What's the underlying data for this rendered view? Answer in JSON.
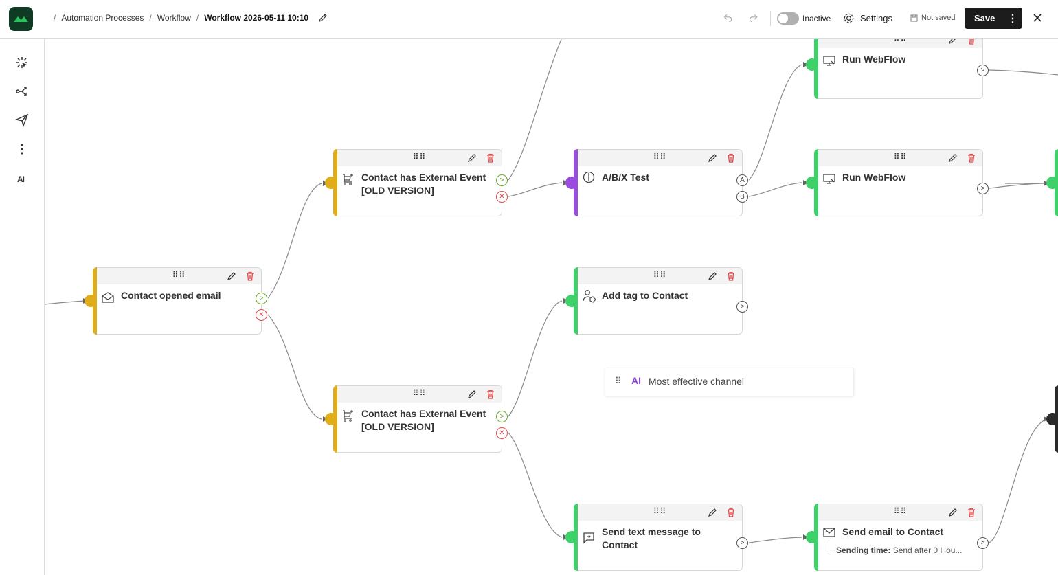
{
  "breadcrumb": {
    "items": [
      "Automation Processes",
      "Workflow"
    ],
    "current": "Workflow 2026-05-11 10:10"
  },
  "toolbar": {
    "status_label": "Inactive",
    "settings_label": "Settings",
    "save_state": "Not saved",
    "save_label": "Save",
    "save_more": "⋮"
  },
  "rail": {
    "ai_label": "AI"
  },
  "colors": {
    "trigger": "#e0ad1a",
    "condition": "#e0ad1a",
    "split": "#9b4ce0",
    "action": "#3ed16a",
    "ok": "#6aa42a",
    "error": "#e44a4a"
  },
  "nodes": [
    {
      "id": "n1",
      "title": "Contact opened email",
      "icon": "envelope-open-icon",
      "kind": "condition"
    },
    {
      "id": "n2",
      "title": "Contact has External Event [OLD VERSION]",
      "icon": "cart-event-icon",
      "kind": "condition"
    },
    {
      "id": "n3",
      "title": "Contact has External Event [OLD VERSION]",
      "icon": "cart-event-icon",
      "kind": "condition"
    },
    {
      "id": "n4",
      "title": "A/B/X Test",
      "icon": "split-test-icon",
      "kind": "split",
      "ports": [
        "A",
        "B"
      ]
    },
    {
      "id": "n5",
      "title": "Add tag to Contact",
      "icon": "tag-user-icon",
      "kind": "action"
    },
    {
      "id": "n6",
      "title": "Send text message to Contact",
      "icon": "sms-icon",
      "kind": "action"
    },
    {
      "id": "n7",
      "title": "Run WebFlow",
      "icon": "webflow-icon",
      "kind": "action"
    },
    {
      "id": "n8",
      "title": "Run WebFlow",
      "icon": "webflow-icon",
      "kind": "action"
    },
    {
      "id": "n9",
      "title": "Send email to Contact",
      "icon": "email-icon",
      "kind": "action",
      "sub_label": "Sending time:",
      "sub_value": "Send after 0 Hou..."
    }
  ],
  "ai_suggestion": {
    "label": "Most effective channel",
    "badge": "AI"
  }
}
